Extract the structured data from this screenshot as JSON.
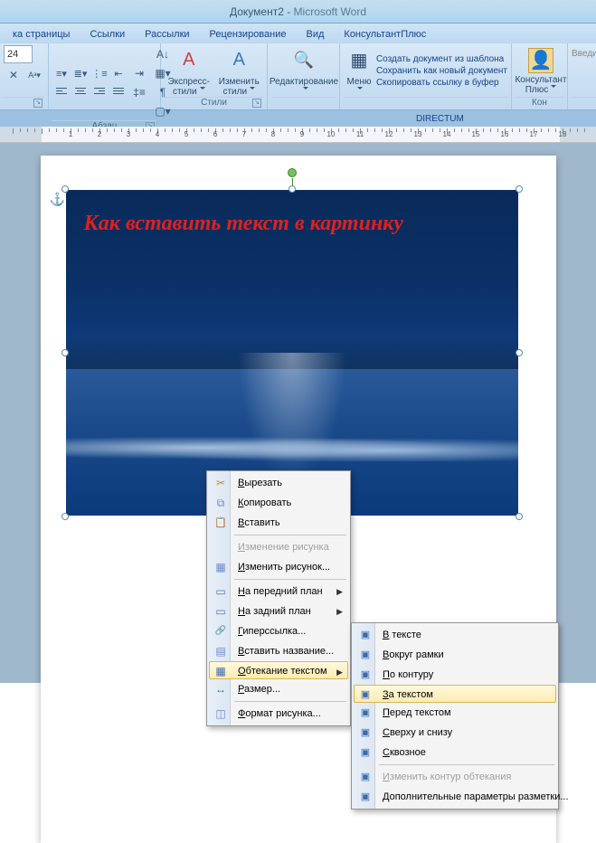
{
  "title": {
    "doc": "Документ2",
    "sep": " - ",
    "app": "Microsoft Word"
  },
  "tabs": [
    "ка страницы",
    "Ссылки",
    "Рассылки",
    "Рецензирование",
    "Вид",
    "КонсультантПлюс"
  ],
  "ribbon": {
    "font": {
      "size": "24",
      "group": ""
    },
    "paragraph": {
      "group": "Абзац"
    },
    "styles": {
      "group": "Стили",
      "express": "Экспресс-стили",
      "change": "Изменить\nстили"
    },
    "editing": {
      "group": "",
      "btn": "Редактирование"
    },
    "menu": {
      "btn": "Меню",
      "links": {
        "tpl": "Создать документ из шаблона",
        "save": "Сохранить как новый документ",
        "copy": "Скопировать ссылку в буфер"
      }
    },
    "konsult": {
      "btn": "Консультант\nПлюс",
      "group": "Кон"
    },
    "vvedit": "Введите"
  },
  "directum": "DIRECTUM",
  "ruler": {
    "start": -3,
    "end": 18,
    "unit": 32
  },
  "image_text": "Как вставить текст в картинку",
  "ctx": {
    "cut": "Вырезать",
    "copy": "Копировать",
    "paste": "Вставить",
    "change_pic": "Изменение рисунка",
    "edit_pic": "Изменить рисунок...",
    "front": "На передний план",
    "back": "На задний план",
    "hyper": "Гиперссылка...",
    "caption": "Вставить название...",
    "wrap": "Обтекание текстом",
    "size": "Размер...",
    "format": "Формат рисунка..."
  },
  "wrap": {
    "inline": "В тексте",
    "square": "Вокруг рамки",
    "tight": "По контуру",
    "behind": "За текстом",
    "front": "Перед текстом",
    "topbot": "Сверху и снизу",
    "through": "Сквозное",
    "edit": "Изменить контур обтекания",
    "more": "Дополнительные параметры разметки..."
  }
}
